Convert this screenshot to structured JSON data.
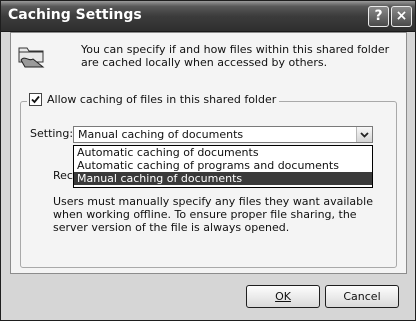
{
  "window": {
    "title": "Caching Settings",
    "help_glyph": "?",
    "close_glyph": "×"
  },
  "intro_text": "You can specify if and how files within this shared folder are cached locally when accessed by others.",
  "allow_caching": {
    "label": "Allow caching of files in this shared folder",
    "checked": true
  },
  "setting": {
    "label": "Setting:",
    "selected": "Manual caching of documents",
    "options": [
      "Automatic caching of documents",
      "Automatic caching of programs and documents",
      "Manual caching of documents"
    ]
  },
  "recommendation_partial": "Rec",
  "description": "Users must manually specify any files they want available when working offline. To ensure proper file sharing, the server version of the file is always opened.",
  "buttons": {
    "ok": "OK",
    "cancel": "Cancel"
  },
  "icons": {
    "folder": "shared-folder-icon",
    "dropdown": "chevron-down-icon",
    "check": "checkmark-icon"
  }
}
